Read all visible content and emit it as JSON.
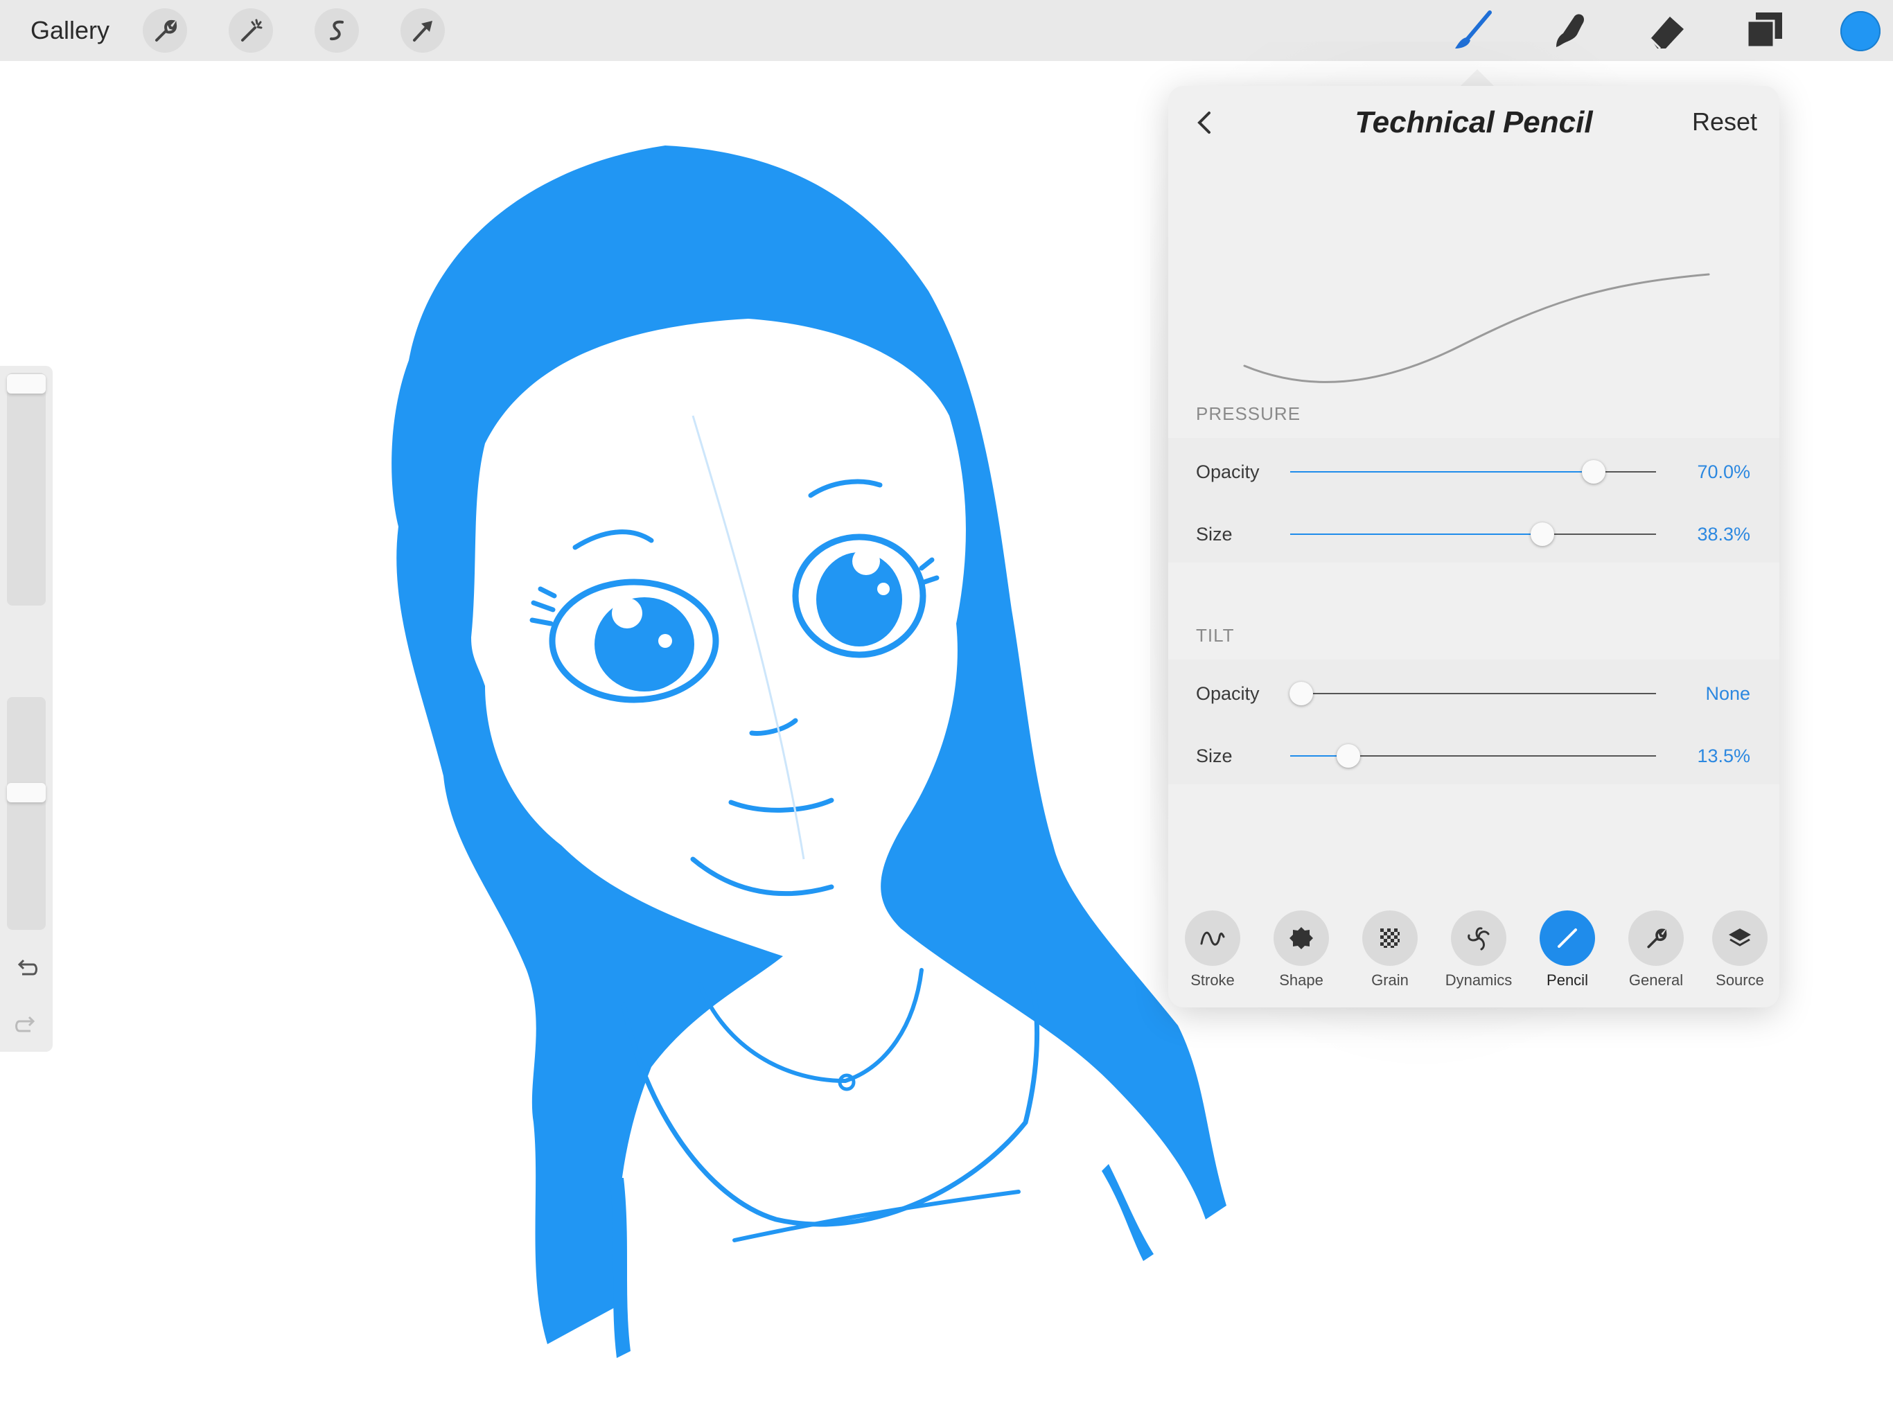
{
  "topbar": {
    "gallery_label": "Gallery",
    "left_tools": [
      "wrench-icon",
      "magic-wand-icon",
      "selection-s-icon",
      "move-arrow-icon"
    ],
    "right_tools": [
      "brush-icon",
      "smudge-icon",
      "eraser-icon",
      "layers-icon"
    ],
    "current_color": "#2196f3"
  },
  "sidebar": {
    "undo_icon": "undo-arrow-icon",
    "redo_icon": "redo-arrow-icon"
  },
  "brush_panel": {
    "title": "Technical Pencil",
    "reset_label": "Reset",
    "pressure": {
      "section_label": "PRESSURE",
      "opacity": {
        "label": "Opacity",
        "value_text": "70.0%",
        "fraction": 0.83
      },
      "size": {
        "label": "Size",
        "value_text": "38.3%",
        "fraction": 0.69
      }
    },
    "tilt": {
      "section_label": "TILT",
      "opacity": {
        "label": "Opacity",
        "value_text": "None",
        "fraction": 0.03
      },
      "size": {
        "label": "Size",
        "value_text": "13.5%",
        "fraction": 0.16
      }
    },
    "tabs": [
      {
        "label": "Stroke",
        "icon": "stroke-wave-icon",
        "active": false
      },
      {
        "label": "Shape",
        "icon": "shape-blob-icon",
        "active": false
      },
      {
        "label": "Grain",
        "icon": "grain-checker-icon",
        "active": false
      },
      {
        "label": "Dynamics",
        "icon": "dynamics-swirl-icon",
        "active": false
      },
      {
        "label": "Pencil",
        "icon": "pencil-line-icon",
        "active": true
      },
      {
        "label": "General",
        "icon": "general-wrench-icon",
        "active": false
      },
      {
        "label": "Source",
        "icon": "source-layers-icon",
        "active": false
      }
    ]
  },
  "accent_color": "#1f8ceb",
  "drawing_color": "#2196f3"
}
